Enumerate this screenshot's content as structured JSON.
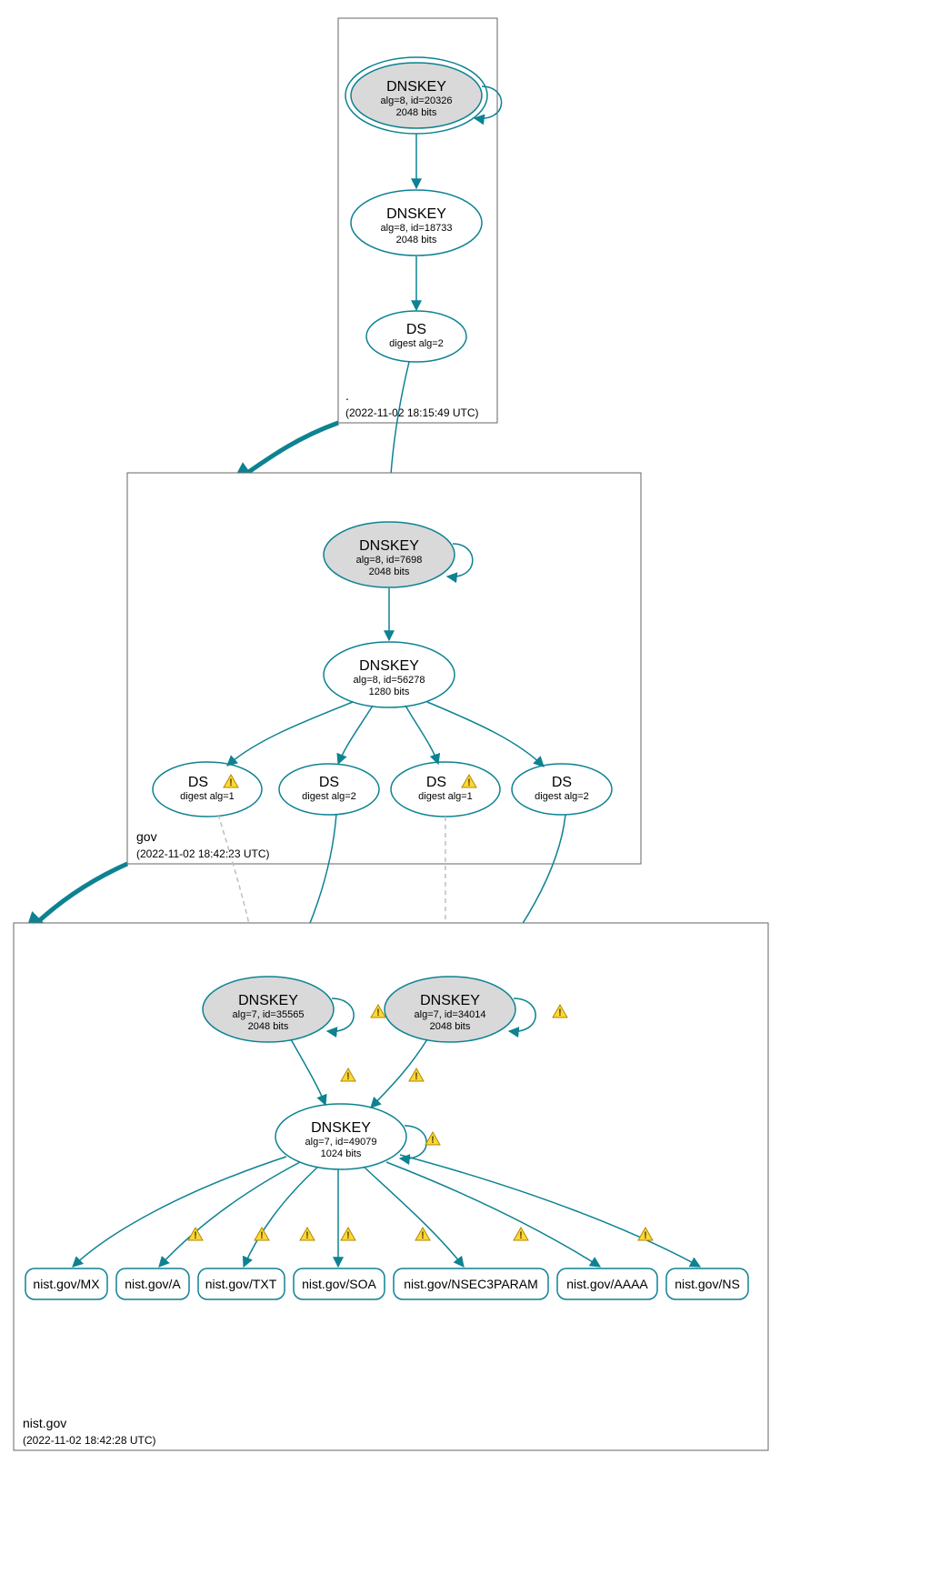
{
  "labels": {
    "dnskey": "DNSKEY",
    "ds": "DS"
  },
  "zones": {
    "root": {
      "name": ".",
      "timestamp": "(2022-11-02 18:15:49 UTC)",
      "ksk": {
        "line1": "alg=8, id=20326",
        "line2": "2048 bits"
      },
      "zsk": {
        "line1": "alg=8, id=18733",
        "line2": "2048 bits"
      },
      "ds": {
        "line1": "digest alg=2"
      }
    },
    "gov": {
      "name": "gov",
      "timestamp": "(2022-11-02 18:42:23 UTC)",
      "ksk": {
        "line1": "alg=8, id=7698",
        "line2": "2048 bits"
      },
      "zsk": {
        "line1": "alg=8, id=56278",
        "line2": "1280 bits"
      },
      "ds1": {
        "line1": "digest alg=1"
      },
      "ds2": {
        "line1": "digest alg=2"
      },
      "ds3": {
        "line1": "digest alg=1"
      },
      "ds4": {
        "line1": "digest alg=2"
      }
    },
    "nist": {
      "name": "nist.gov",
      "timestamp": "(2022-11-02 18:42:28 UTC)",
      "ksk1": {
        "line1": "alg=7, id=35565",
        "line2": "2048 bits"
      },
      "ksk2": {
        "line1": "alg=7, id=34014",
        "line2": "2048 bits"
      },
      "zsk": {
        "line1": "alg=7, id=49079",
        "line2": "1024 bits"
      }
    }
  },
  "rrsets": {
    "mx": "nist.gov/MX",
    "a": "nist.gov/A",
    "txt": "nist.gov/TXT",
    "soa": "nist.gov/SOA",
    "nsec": "nist.gov/NSEC3PARAM",
    "aaaa": "nist.gov/AAAA",
    "ns": "nist.gov/NS"
  }
}
